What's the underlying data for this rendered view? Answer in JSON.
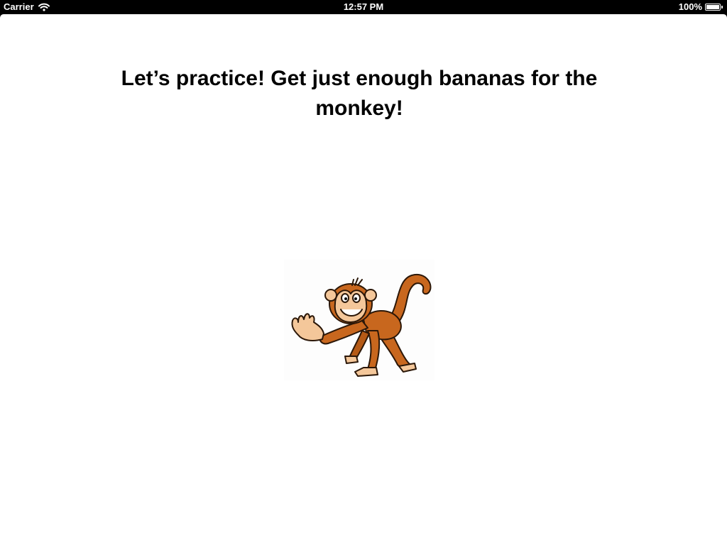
{
  "status_bar": {
    "carrier": "Carrier",
    "time": "12:57 PM",
    "battery_text": "100%",
    "battery_level": 1.0
  },
  "content": {
    "prompt": "Let’s practice! Get just enough bananas for the monkey!",
    "image_icon": "monkey-icon"
  }
}
